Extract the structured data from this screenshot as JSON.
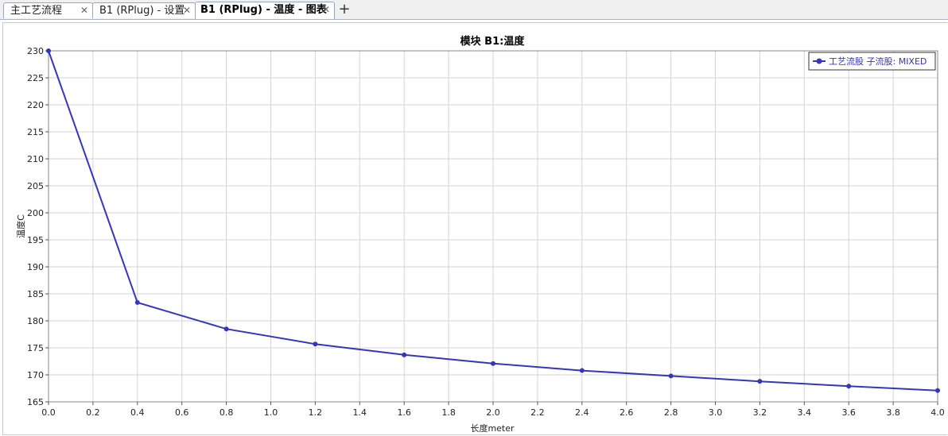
{
  "tabs": [
    {
      "label": "主工艺流程",
      "close": "✕"
    },
    {
      "label": "B1 (RPlug) - 设置",
      "close": "✕"
    },
    {
      "label": "B1 (RPlug) - 温度 - 图表",
      "close": "✕"
    }
  ],
  "add_tab": "+",
  "colors": {
    "series": "#3636b8",
    "grid": "#d3d3d3"
  },
  "chart_data": {
    "type": "line",
    "title": "模块 B1:温度",
    "xlabel": "长度meter",
    "ylabel": "温度C",
    "xlim": [
      0.0,
      4.0
    ],
    "ylim": [
      165,
      230
    ],
    "x_ticks": [
      "0.0",
      "0.2",
      "0.4",
      "0.6",
      "0.8",
      "1.0",
      "1.2",
      "1.4",
      "1.6",
      "1.8",
      "2.0",
      "2.2",
      "2.4",
      "2.6",
      "2.8",
      "3.0",
      "3.2",
      "3.4",
      "3.6",
      "3.8",
      "4.0"
    ],
    "y_ticks": [
      "165",
      "170",
      "175",
      "180",
      "185",
      "190",
      "195",
      "200",
      "205",
      "210",
      "215",
      "220",
      "225",
      "230"
    ],
    "grid": true,
    "legend_position": "top-right",
    "series": [
      {
        "name": "工艺流股 子流股: MIXED",
        "x": [
          0.0,
          0.4,
          0.8,
          1.2,
          1.6,
          2.0,
          2.4,
          2.8,
          3.2,
          3.6,
          4.0
        ],
        "y": [
          230.0,
          183.4,
          178.5,
          175.7,
          173.7,
          172.1,
          170.8,
          169.8,
          168.8,
          167.9,
          167.1
        ]
      }
    ]
  }
}
